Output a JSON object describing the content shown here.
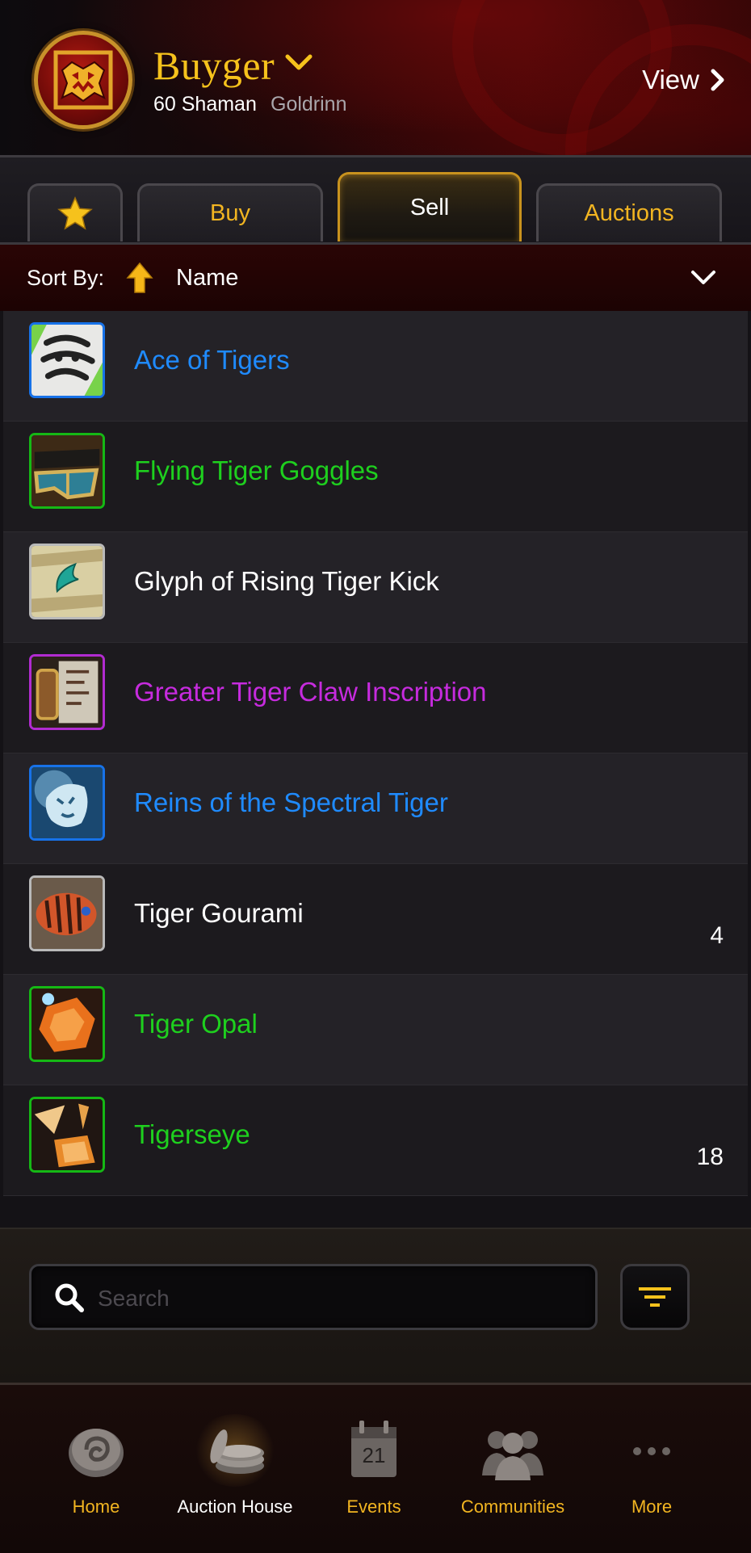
{
  "header": {
    "character_name": "Buyger",
    "level_class": "60 Shaman",
    "realm": "Goldrinn",
    "view_label": "View",
    "crest_icon": "horde-crest-icon",
    "accent_color": "#f6c21c"
  },
  "tabs": [
    {
      "label": "",
      "icon": "star-icon"
    },
    {
      "label": "Buy"
    },
    {
      "label": "Sell",
      "active": true
    },
    {
      "label": "Auctions"
    }
  ],
  "sort": {
    "label": "Sort By:",
    "value": "Name",
    "direction_icon": "arrow-up-icon"
  },
  "items": [
    {
      "name": "Ace of Tigers",
      "quality_color": "#1f8bff",
      "quantity": ""
    },
    {
      "name": "Flying Tiger Goggles",
      "quality_color": "#1ed01e",
      "quantity": ""
    },
    {
      "name": "Glyph of Rising Tiger Kick",
      "quality_color": "#ffffff",
      "quantity": ""
    },
    {
      "name": "Greater Tiger Claw Inscription",
      "quality_color": "#c62bde",
      "quantity": ""
    },
    {
      "name": "Reins of the Spectral Tiger",
      "quality_color": "#1f8bff",
      "quantity": ""
    },
    {
      "name": "Tiger Gourami",
      "quality_color": "#ffffff",
      "quantity": "4"
    },
    {
      "name": "Tiger Opal",
      "quality_color": "#1ed01e",
      "quantity": ""
    },
    {
      "name": "Tigerseye",
      "quality_color": "#1ed01e",
      "quantity": "18"
    }
  ],
  "search": {
    "placeholder": "Search",
    "value": ""
  },
  "nav": [
    {
      "label": "Home",
      "icon": "hearthstone-icon"
    },
    {
      "label": "Auction House",
      "icon": "coins-icon",
      "active": true
    },
    {
      "label": "Events",
      "icon": "calendar-icon",
      "day": "21"
    },
    {
      "label": "Communities",
      "icon": "people-icon"
    },
    {
      "label": "More",
      "icon": "more-dots-icon"
    }
  ]
}
